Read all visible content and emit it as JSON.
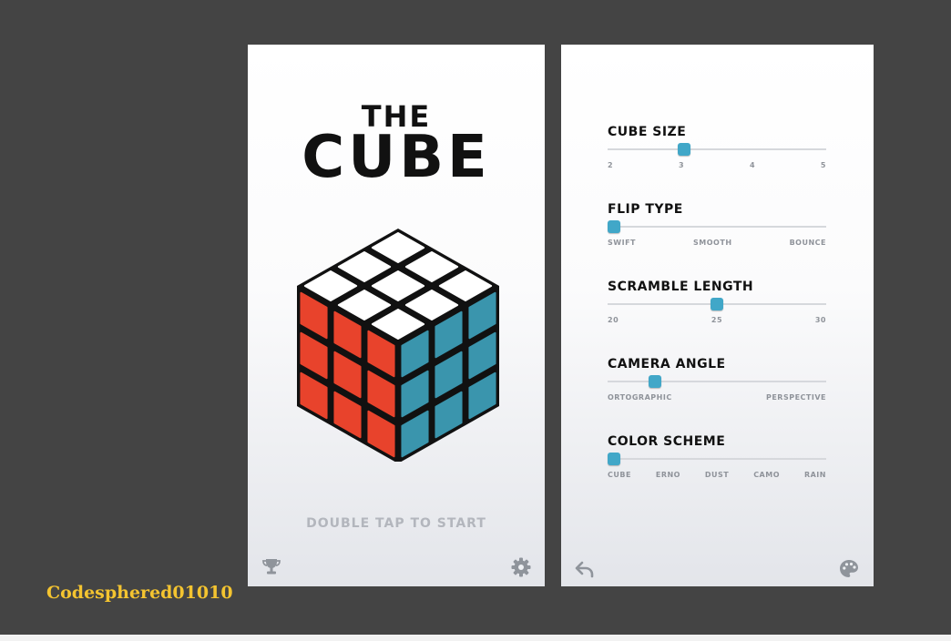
{
  "colors": {
    "background": "#444444",
    "accent": "#41a7c8",
    "cube_white": "#ffffff",
    "cube_red": "#e8432c",
    "cube_blue": "#3a95ad",
    "watermark": "#f4c430"
  },
  "title": {
    "line1": "THE",
    "line2": "CUBE"
  },
  "start_hint": "DOUBLE TAP TO START",
  "icons": {
    "left_bottom_left": "trophy-icon",
    "left_bottom_right": "gear-icon",
    "right_bottom_left": "back-arrow-icon",
    "right_bottom_right": "palette-icon"
  },
  "settings": {
    "cube_size": {
      "label": "CUBE SIZE",
      "options": [
        "2",
        "3",
        "4",
        "5"
      ],
      "value": 3,
      "position": 0.34
    },
    "flip_type": {
      "label": "FLIP TYPE",
      "options": [
        "SWIFT",
        "SMOOTH",
        "BOUNCE"
      ],
      "value": "SWIFT",
      "position": 0.0
    },
    "scramble_length": {
      "label": "SCRAMBLE LENGTH",
      "options": [
        "20",
        "25",
        "30"
      ],
      "value": 25,
      "position": 0.5
    },
    "camera_angle": {
      "label": "CAMERA ANGLE",
      "options": [
        "ORTOGRAPHIC",
        "PERSPECTIVE"
      ],
      "value": 0.2,
      "position": 0.2
    },
    "color_scheme": {
      "label": "COLOR SCHEME",
      "options": [
        "CUBE",
        "ERNO",
        "DUST",
        "CAMO",
        "RAIN"
      ],
      "value": "CUBE",
      "position": 0.0
    }
  },
  "watermark": "Codesphered01010"
}
